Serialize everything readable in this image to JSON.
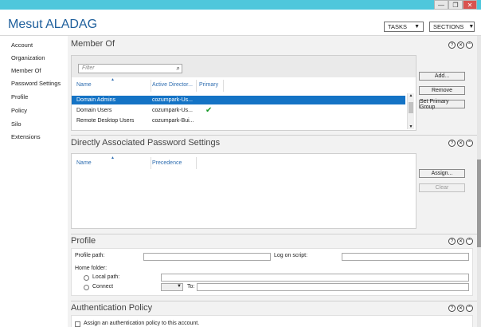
{
  "window": {
    "controls": [
      "—",
      "❐",
      "✕"
    ]
  },
  "header": {
    "title": "Mesut ALADAG",
    "tasks_label": "TASKS",
    "sections_label": "SECTIONS"
  },
  "nav": {
    "items": [
      "Account",
      "Organization",
      "Member Of",
      "Password Settings",
      "Profile",
      "Policy",
      "Silo",
      "Extensions"
    ]
  },
  "member_of": {
    "title": "Member Of",
    "filter_placeholder": "Filter",
    "columns": [
      "Name",
      "Active Director...",
      "Primary"
    ],
    "rows": [
      {
        "name": "Domain Admins",
        "path": "cozumpark-Us...",
        "primary": ""
      },
      {
        "name": "Domain Users",
        "path": "cozumpark-Us...",
        "primary": "✔"
      },
      {
        "name": "Remote Desktop Users",
        "path": "cozumpark-Bui...",
        "primary": ""
      }
    ],
    "buttons": {
      "add": "Add...",
      "remove": "Remove",
      "set_primary": "Set Primary Group"
    }
  },
  "password_settings": {
    "title": "Directly Associated Password Settings",
    "columns": [
      "Name",
      "Precedence"
    ],
    "buttons": {
      "assign": "Assign...",
      "clear": "Clear"
    }
  },
  "profile": {
    "title": "Profile",
    "profile_path_label": "Profile path:",
    "logon_script_label": "Log on script:",
    "home_folder_label": "Home folder:",
    "local_path_label": "Local path:",
    "connect_label": "Connect",
    "to_label": "To:"
  },
  "auth_policy": {
    "title": "Authentication Policy",
    "assign_label": "Assign an authentication policy to this account."
  },
  "section_icons": [
    "?",
    "✕",
    "⌃"
  ]
}
